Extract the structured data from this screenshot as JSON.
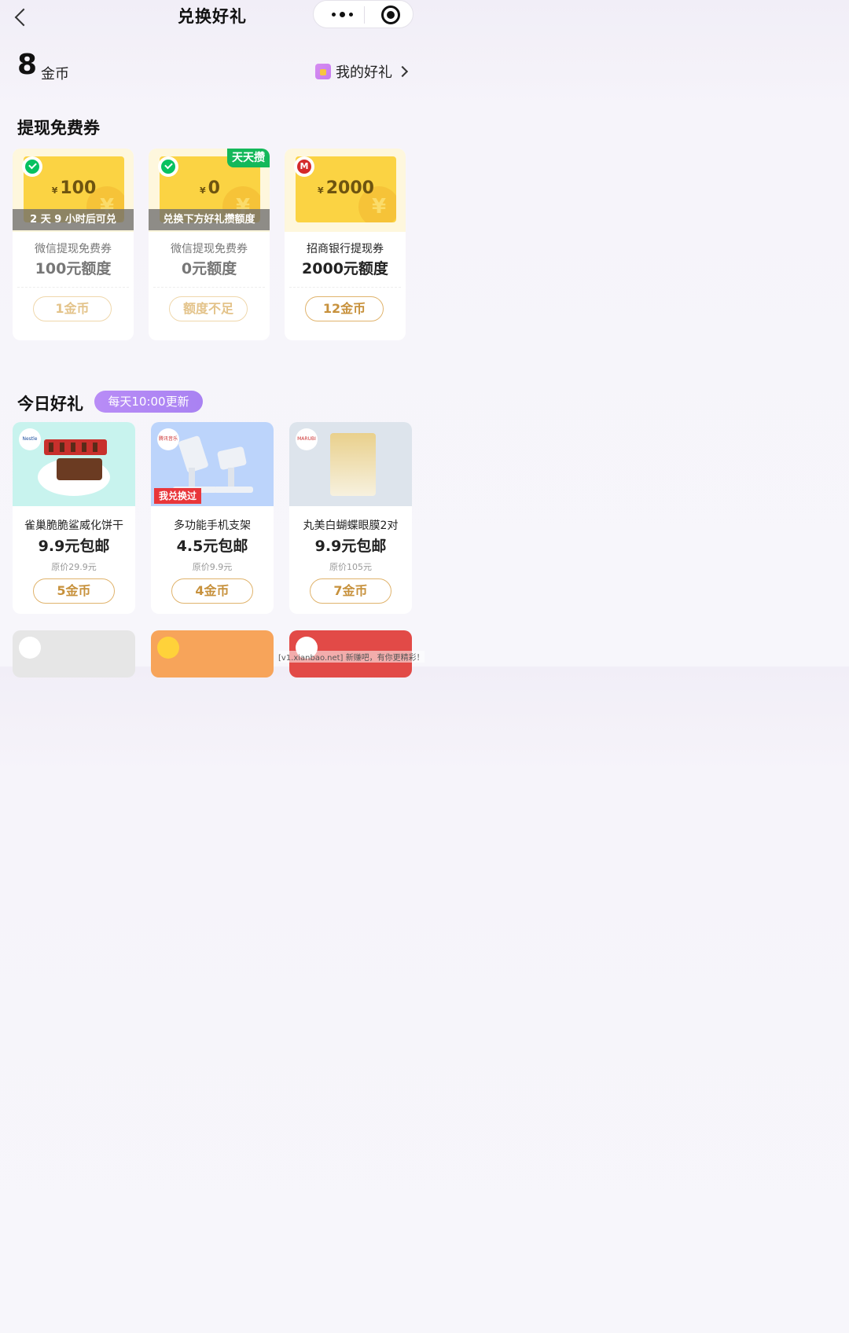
{
  "header": {
    "title": "兑换好礼"
  },
  "coins": {
    "amount": "8",
    "unit": "金币"
  },
  "my_gifts": "我的好礼",
  "withdraw": {
    "title": "提现免费券",
    "cards": [
      {
        "amount": "100",
        "band": "2 天 9 小时后可兑",
        "name": "微信提现免费券",
        "quota": "100元额度",
        "button": "1金币",
        "logo": "wechat-pay-icon"
      },
      {
        "amount": "0",
        "tag": "天天攒",
        "band": "兑换下方好礼攒额度",
        "name": "微信提现免费券",
        "quota": "0元额度",
        "button": "额度不足",
        "logo": "wechat-pay-icon"
      },
      {
        "amount": "2000",
        "name": "招商银行提现券",
        "quota": "2000元额度",
        "button": "12金币",
        "logo": "cmb-bank-icon"
      }
    ]
  },
  "today": {
    "title": "今日好礼",
    "badge": "每天10:00更新",
    "products": [
      {
        "name": "雀巢脆脆鲨威化饼干",
        "price": "9.9元包邮",
        "original": "原价29.9元",
        "button": "5金币",
        "logo_text": "Nestle"
      },
      {
        "name": "多功能手机支架",
        "price": "4.5元包邮",
        "original": "原价9.9元",
        "button": "4金币",
        "tag": "我兑换过",
        "logo_text": "腾讯音乐"
      },
      {
        "name": "丸美白蝴蝶眼膜2对",
        "price": "9.9元包邮",
        "original": "原价105元",
        "button": "7金币",
        "logo_text": "MARUBI 丸美"
      }
    ]
  },
  "watermark": "[v1.xianbao.net] 新赚吧，有你更精彩！",
  "colors": {
    "gold": "#fbd343",
    "wechat_green": "#07c160",
    "tag_green": "#14b85a",
    "badge_purple": "#b88cf6",
    "button_gold": "#c7913c",
    "red_tag": "#e9363a"
  }
}
